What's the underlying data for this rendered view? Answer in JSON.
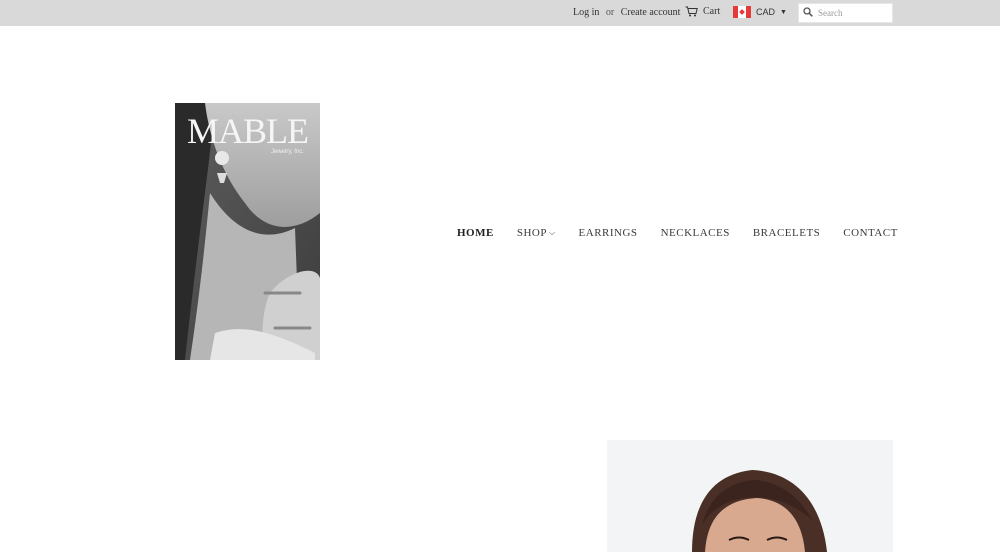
{
  "topbar": {
    "login": "Log in",
    "or": "or",
    "create_account": "Create account",
    "cart": "Cart",
    "currency": "CAD",
    "search_placeholder": "Search"
  },
  "logo": {
    "wordmark": "MABLE",
    "subtitle": "Jewelry, Inc."
  },
  "nav": {
    "items": [
      "HOME",
      "SHOP",
      "EARRINGS",
      "NECKLACES",
      "BRACELETS",
      "CONTACT"
    ]
  },
  "colors": {
    "topbar_bg": "#d9d9d9",
    "page_bg": "#ffffff",
    "text": "#3a3a3a"
  },
  "icons": {
    "cart": "cart-icon",
    "flag": "canada-flag-icon",
    "search": "search-icon",
    "shop_dropdown": "chevron-down-icon",
    "currency_dropdown": "caret-down-icon"
  }
}
